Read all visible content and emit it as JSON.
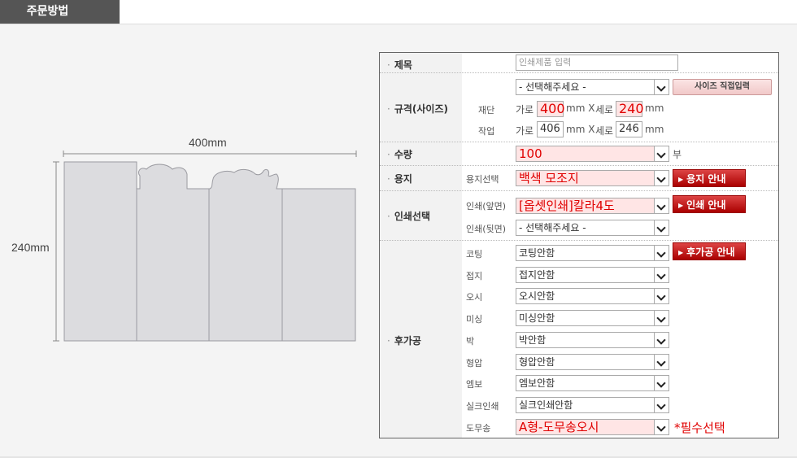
{
  "tab": {
    "title": "주문방법"
  },
  "diagram": {
    "width_label": "400mm",
    "height_label": "240mm"
  },
  "form": {
    "title": {
      "label": "제목",
      "placeholder": "인쇄제품 입력"
    },
    "size": {
      "label": "규격(사이즈)",
      "select": "- 선택해주세요 -",
      "direct_button": "사이즈 직접입력",
      "cut": {
        "label": "재단",
        "w_label": "가로",
        "w": "400",
        "unit1": "mm X",
        "h_label": "세로",
        "h": "240",
        "unit2": "mm"
      },
      "work": {
        "label": "작업",
        "w_label": "가로",
        "w": "406",
        "unit1": "mm X",
        "h_label": "세로",
        "h": "246",
        "unit2": "mm"
      }
    },
    "quantity": {
      "label": "수량",
      "value": "100",
      "unit": "부"
    },
    "paper": {
      "label": "용지",
      "sub": "용지선택",
      "value": "백색 모조지",
      "guide": "용지 안내"
    },
    "print": {
      "label": "인쇄선택",
      "front_label": "인쇄(앞면)",
      "front_value": "[옵셋인쇄]칼라4도",
      "back_label": "인쇄(뒷면)",
      "back_value": "- 선택해주세요 -",
      "guide": "인쇄 안내"
    },
    "post": {
      "label": "후가공",
      "guide": "후가공 안내",
      "items": [
        {
          "label": "코팅",
          "value": "코팅안함"
        },
        {
          "label": "접지",
          "value": "접지안함"
        },
        {
          "label": "오시",
          "value": "오시안함"
        },
        {
          "label": "미싱",
          "value": "미싱안함"
        },
        {
          "label": "박",
          "value": "박안함"
        },
        {
          "label": "형압",
          "value": "형압안함"
        },
        {
          "label": "엠보",
          "value": "엠보안함"
        },
        {
          "label": "실크인쇄",
          "value": "실크인쇄안함"
        },
        {
          "label": "도무송",
          "value": "A형-도무송오시"
        }
      ],
      "required_note": "*필수선택"
    }
  },
  "colors": {
    "accent_red": "#e00000",
    "button_red": "#b01010",
    "tab_bg": "#555555"
  }
}
